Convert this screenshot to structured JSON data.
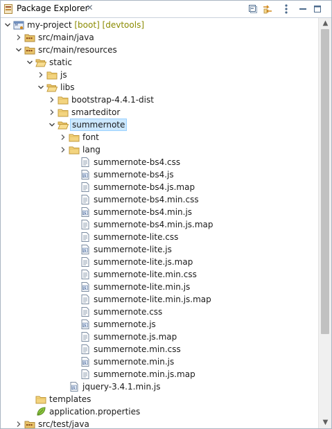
{
  "view": {
    "title": "Package Explorer",
    "close_glyph": "✕"
  },
  "toolbar": [
    "collapse-all-icon",
    "link-with-editor-icon",
    "view-menu-icon",
    "minimize-icon",
    "maximize-icon"
  ],
  "tree": [
    {
      "level": 0,
      "label": "my-project",
      "decoration": " [boot] [devtools]",
      "icon": "project-icon",
      "toggle": "expanded"
    },
    {
      "level": 1,
      "label": "src/main/java",
      "icon": "source-folder-icon",
      "toggle": "collapsed"
    },
    {
      "level": 1,
      "label": "src/main/resources",
      "icon": "source-folder-icon",
      "toggle": "expanded"
    },
    {
      "level": 2,
      "label": "static",
      "icon": "folder-open-icon",
      "toggle": "expanded"
    },
    {
      "level": 3,
      "label": "js",
      "icon": "folder-icon",
      "toggle": "collapsed"
    },
    {
      "level": 3,
      "label": "libs",
      "icon": "folder-open-icon",
      "toggle": "expanded"
    },
    {
      "level": 4,
      "label": "bootstrap-4.4.1-dist",
      "icon": "folder-icon",
      "toggle": "collapsed"
    },
    {
      "level": 4,
      "label": "smarteditor",
      "icon": "folder-icon",
      "toggle": "collapsed"
    },
    {
      "level": 4,
      "label": "summernote",
      "icon": "folder-open-icon",
      "toggle": "expanded",
      "selected": true
    },
    {
      "level": 5,
      "label": "font",
      "icon": "folder-icon",
      "toggle": "collapsed"
    },
    {
      "level": 5,
      "label": "lang",
      "icon": "folder-icon",
      "toggle": "collapsed"
    },
    {
      "level": 6,
      "label": "summernote-bs4.css",
      "icon": "text-file-icon"
    },
    {
      "level": 6,
      "label": "summernote-bs4.js",
      "icon": "js-file-icon"
    },
    {
      "level": 6,
      "label": "summernote-bs4.js.map",
      "icon": "text-file-icon"
    },
    {
      "level": 6,
      "label": "summernote-bs4.min.css",
      "icon": "text-file-icon"
    },
    {
      "level": 6,
      "label": "summernote-bs4.min.js",
      "icon": "js-file-icon"
    },
    {
      "level": 6,
      "label": "summernote-bs4.min.js.map",
      "icon": "text-file-icon"
    },
    {
      "level": 6,
      "label": "summernote-lite.css",
      "icon": "text-file-icon"
    },
    {
      "level": 6,
      "label": "summernote-lite.js",
      "icon": "js-file-icon"
    },
    {
      "level": 6,
      "label": "summernote-lite.js.map",
      "icon": "text-file-icon"
    },
    {
      "level": 6,
      "label": "summernote-lite.min.css",
      "icon": "text-file-icon"
    },
    {
      "level": 6,
      "label": "summernote-lite.min.js",
      "icon": "js-file-icon"
    },
    {
      "level": 6,
      "label": "summernote-lite.min.js.map",
      "icon": "text-file-icon"
    },
    {
      "level": 6,
      "label": "summernote.css",
      "icon": "text-file-icon"
    },
    {
      "level": 6,
      "label": "summernote.js",
      "icon": "js-file-icon"
    },
    {
      "level": 6,
      "label": "summernote.js.map",
      "icon": "text-file-icon"
    },
    {
      "level": 6,
      "label": "summernote.min.css",
      "icon": "text-file-icon"
    },
    {
      "level": 6,
      "label": "summernote.min.js",
      "icon": "js-file-icon"
    },
    {
      "level": 6,
      "label": "summernote.min.js.map",
      "icon": "text-file-icon"
    },
    {
      "level": 5,
      "label": "jquery-3.4.1.min.js",
      "icon": "js-file-icon"
    },
    {
      "level": 2,
      "label": "templates",
      "icon": "folder-icon"
    },
    {
      "level": 2,
      "label": "application.properties",
      "icon": "properties-leaf-icon"
    },
    {
      "level": 1,
      "label": "src/test/java",
      "icon": "source-folder-icon",
      "toggle": "collapsed"
    }
  ],
  "scrollbar": {
    "up_glyph": "▲",
    "down_glyph": "▼"
  }
}
